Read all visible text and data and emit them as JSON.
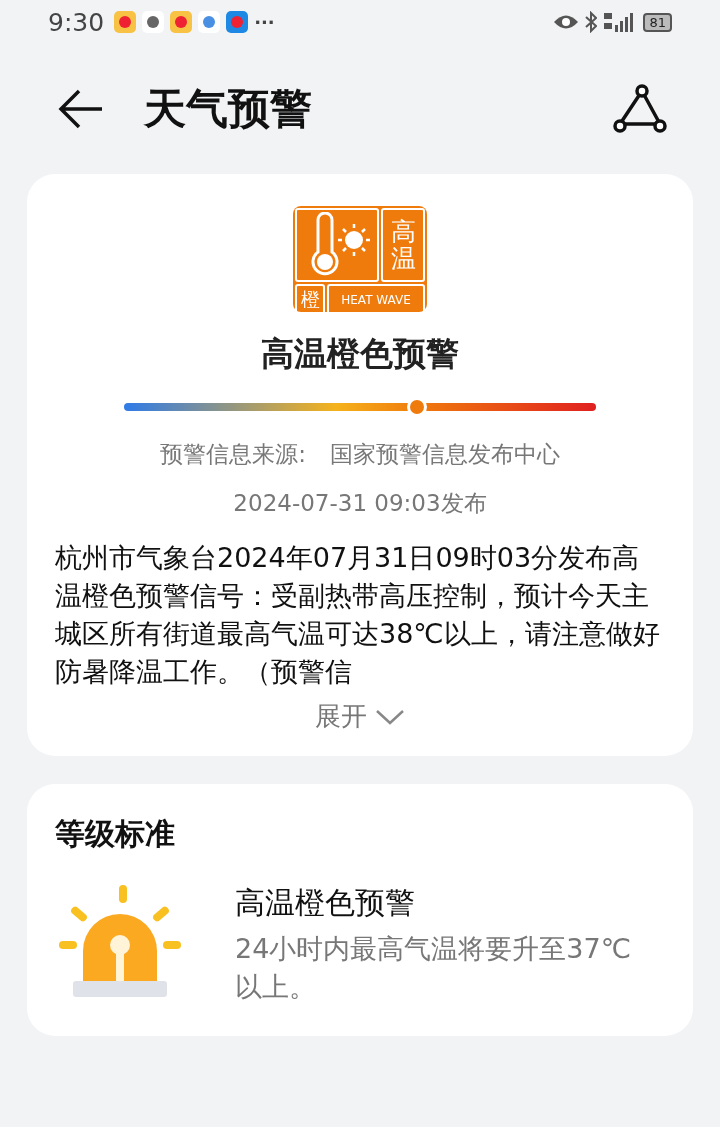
{
  "status_bar": {
    "time": "9:30",
    "more": "···",
    "battery": "81"
  },
  "header": {
    "title": "天气预警"
  },
  "alert": {
    "badge": {
      "main": "高温",
      "level": "橙",
      "english": "HEAT WAVE"
    },
    "title": "高温橙色预警",
    "level": 0.62,
    "source_label": "预警信息来源:",
    "source": "国家预警信息发布中心",
    "published": "2024-07-31 09:03发布",
    "description": "杭州市气象台2024年07月31日09时03分发布高温橙色预警信号：受副热带高压控制，预计今天主城区所有街道最高气温可达38℃以上，请注意做好防暑降温工作。（预警信",
    "expand": "展开"
  },
  "standard": {
    "heading": "等级标准",
    "name": "高温橙色预警",
    "text": "24小时内最高气温将要升至37℃以上。"
  }
}
